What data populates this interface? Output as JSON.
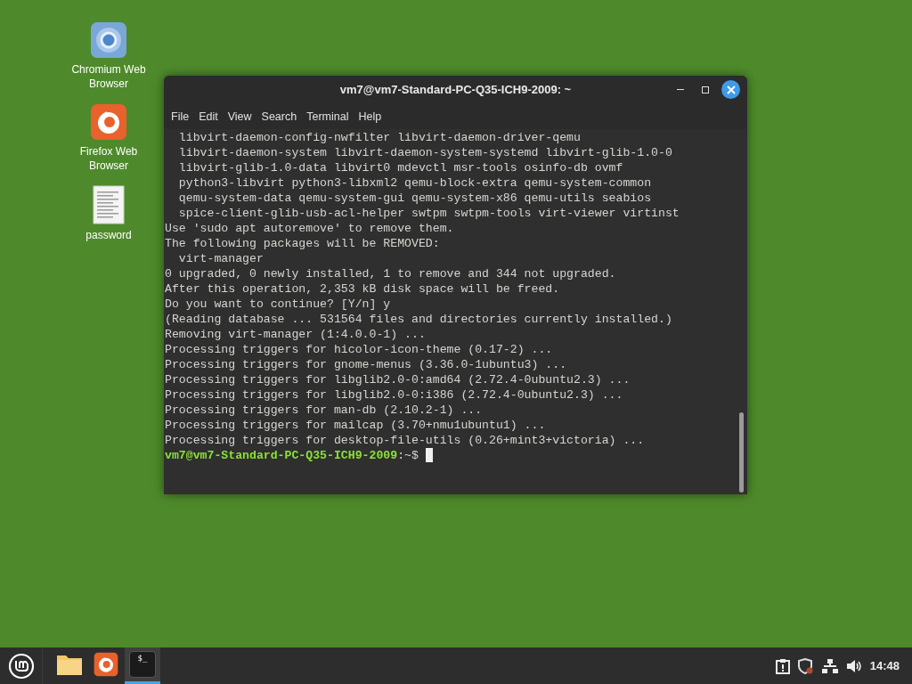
{
  "desktop": {
    "icons": [
      {
        "kind": "chromium",
        "label": "Chromium Web Browser"
      },
      {
        "kind": "firefox",
        "label": "Firefox Web Browser"
      },
      {
        "kind": "document",
        "label": "password"
      }
    ]
  },
  "window": {
    "title": "vm7@vm7-Standard-PC-Q35-ICH9-2009: ~",
    "menu": [
      "File",
      "Edit",
      "View",
      "Search",
      "Terminal",
      "Help"
    ],
    "lines": [
      {
        "kind": "output",
        "text": "  libvirt-daemon-config-nwfilter libvirt-daemon-driver-qemu"
      },
      {
        "kind": "output",
        "text": "  libvirt-daemon-system libvirt-daemon-system-systemd libvirt-glib-1.0-0"
      },
      {
        "kind": "output",
        "text": "  libvirt-glib-1.0-data libvirt0 mdevctl msr-tools osinfo-db ovmf"
      },
      {
        "kind": "output",
        "text": "  python3-libvirt python3-libxml2 qemu-block-extra qemu-system-common"
      },
      {
        "kind": "output",
        "text": "  qemu-system-data qemu-system-gui qemu-system-x86 qemu-utils seabios"
      },
      {
        "kind": "output",
        "text": "  spice-client-glib-usb-acl-helper swtpm swtpm-tools virt-viewer virtinst"
      },
      {
        "kind": "output",
        "text": "Use 'sudo apt autoremove' to remove them."
      },
      {
        "kind": "output",
        "text": "The following packages will be REMOVED:"
      },
      {
        "kind": "output",
        "text": "  virt-manager"
      },
      {
        "kind": "output",
        "text": "0 upgraded, 0 newly installed, 1 to remove and 344 not upgraded."
      },
      {
        "kind": "output",
        "text": "After this operation, 2,353 kB disk space will be freed."
      },
      {
        "kind": "output",
        "text": "Do you want to continue? [Y/n] y"
      },
      {
        "kind": "output",
        "text": "(Reading database ... 531564 files and directories currently installed.)"
      },
      {
        "kind": "output",
        "text": "Removing virt-manager (1:4.0.0-1) ..."
      },
      {
        "kind": "output",
        "text": "Processing triggers for hicolor-icon-theme (0.17-2) ..."
      },
      {
        "kind": "output",
        "text": "Processing triggers for gnome-menus (3.36.0-1ubuntu3) ..."
      },
      {
        "kind": "output",
        "text": "Processing triggers for libglib2.0-0:amd64 (2.72.4-0ubuntu2.3) ..."
      },
      {
        "kind": "output",
        "text": "Processing triggers for libglib2.0-0:i386 (2.72.4-0ubuntu2.3) ..."
      },
      {
        "kind": "output",
        "text": "Processing triggers for man-db (2.10.2-1) ..."
      },
      {
        "kind": "output",
        "text": "Processing triggers for mailcap (3.70+nmu1ubuntu1) ..."
      },
      {
        "kind": "output",
        "text": "Processing triggers for desktop-file-utils (0.26+mint3+victoria) ..."
      },
      {
        "kind": "prompt",
        "user": "vm7@vm7-Standard-PC-Q35-ICH9-2009",
        "path": ":~$"
      }
    ]
  },
  "taskbar": {
    "apps": [
      {
        "kind": "files",
        "selected": false
      },
      {
        "kind": "firefox",
        "selected": false
      },
      {
        "kind": "terminal",
        "selected": true,
        "glyph": "$_"
      }
    ],
    "clock": "14:48"
  }
}
